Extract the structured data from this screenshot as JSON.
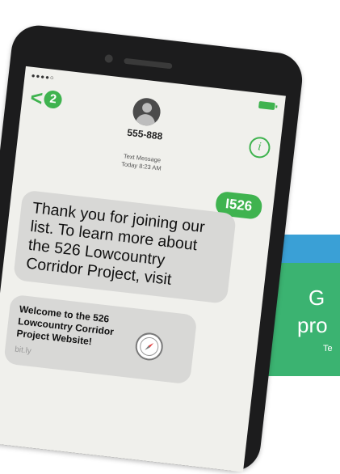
{
  "status": {
    "signal_dots": "●●●●○"
  },
  "nav": {
    "back_chevron": "<",
    "unread_count": "2"
  },
  "contact": {
    "number": "555-888"
  },
  "conversation": {
    "meta_line1": "Text Message",
    "meta_line2": "Today 8:23 AM",
    "sent_message": "I526",
    "received_message": "Thank you for joining our list. To learn more about the 526 Lowcountry Corridor Project, visit",
    "link_preview": {
      "title": "Welcome to the 526 Lowcountry Corridor Project Website!",
      "domain": "bit.ly"
    }
  },
  "background": {
    "partial_1": "G",
    "partial_2": "pro",
    "partial_3": "Te"
  },
  "icons": {
    "info": "info-icon",
    "avatar": "avatar-icon",
    "compass": "compass-icon",
    "battery": "battery-icon"
  },
  "colors": {
    "accent_green": "#3fb34f",
    "phone_body": "#1c1c1d",
    "screen_bg": "#f0f0ec",
    "incoming_bubble": "#d8d8d6",
    "bg_blue": "#3aa0d6",
    "bg_green": "#3bb371"
  }
}
